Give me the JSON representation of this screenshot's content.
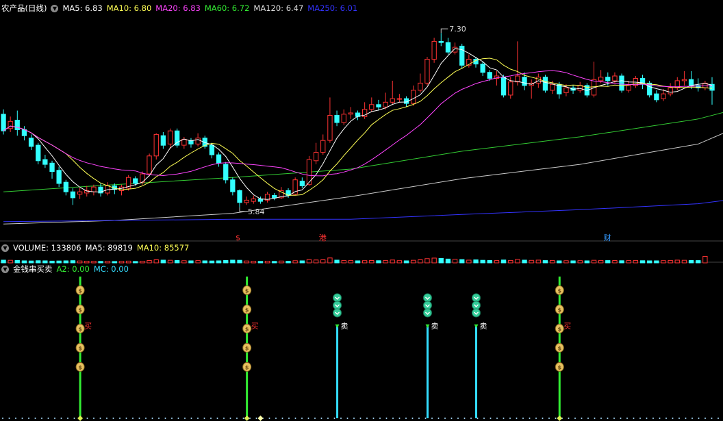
{
  "main_panel": {
    "title": "农产品(日线)",
    "indicators": [
      {
        "label": "MA5: 6.83",
        "color": "#ffffff"
      },
      {
        "label": "MA10: 6.80",
        "color": "#ffff55"
      },
      {
        "label": "MA20: 6.83",
        "color": "#ff44ff"
      },
      {
        "label": "MA60: 6.72",
        "color": "#33ee33"
      },
      {
        "label": "MA120: 6.47",
        "color": "#dddddd"
      },
      {
        "label": "MA250: 6.01",
        "color": "#3333ff"
      }
    ],
    "high_annotation": "7.30",
    "low_annotation": "5.84",
    "event_markers": [
      {
        "label": "$",
        "color": "#ff3333"
      },
      {
        "label": "港",
        "color": "#ff3333"
      },
      {
        "label": "财",
        "color": "#3399ff"
      }
    ]
  },
  "volume_panel": {
    "indicators": [
      {
        "label": "VOLUME: 133806",
        "color": "#ffffff"
      },
      {
        "label": "MA5: 89819",
        "color": "#ffffff"
      },
      {
        "label": "MA10: 85577",
        "color": "#ffff55"
      }
    ]
  },
  "signal_panel": {
    "title": "金钱串买卖",
    "indicators": [
      {
        "label": "A2: 0.00",
        "color": "#33ee33"
      },
      {
        "label": "MC: 0.00",
        "color": "#33ddff"
      }
    ],
    "buy_label": "买",
    "sell_label": "卖",
    "coin_glyph": "$"
  },
  "colors": {
    "up": "#ff3333",
    "down": "#33ffff",
    "buy_line": "#33ee33",
    "sell_line": "#33ddff",
    "coin": "#e8c060"
  },
  "chart_data": {
    "type": "candlestick",
    "ylim": [
      5.65,
      7.45
    ],
    "candles": [
      {
        "o": 6.62,
        "c": 6.48,
        "h": 6.66,
        "l": 6.45
      },
      {
        "o": 6.5,
        "c": 6.56,
        "h": 6.6,
        "l": 6.47
      },
      {
        "o": 6.57,
        "c": 6.49,
        "h": 6.65,
        "l": 6.44
      },
      {
        "o": 6.49,
        "c": 6.44,
        "h": 6.52,
        "l": 6.4
      },
      {
        "o": 6.42,
        "c": 6.35,
        "h": 6.45,
        "l": 6.32
      },
      {
        "o": 6.36,
        "c": 6.23,
        "h": 6.38,
        "l": 6.2
      },
      {
        "o": 6.24,
        "c": 6.2,
        "h": 6.28,
        "l": 6.17
      },
      {
        "o": 6.21,
        "c": 6.14,
        "h": 6.23,
        "l": 6.08
      },
      {
        "o": 6.15,
        "c": 6.04,
        "h": 6.18,
        "l": 6.01
      },
      {
        "o": 6.05,
        "c": 5.97,
        "h": 6.07,
        "l": 5.94
      },
      {
        "o": 5.97,
        "c": 5.92,
        "h": 6.0,
        "l": 5.86
      },
      {
        "o": 5.95,
        "c": 5.97,
        "h": 6.0,
        "l": 5.91
      },
      {
        "o": 5.96,
        "c": 5.98,
        "h": 6.02,
        "l": 5.93
      },
      {
        "o": 5.97,
        "c": 6.01,
        "h": 6.03,
        "l": 5.94
      },
      {
        "o": 6.01,
        "c": 5.96,
        "h": 6.04,
        "l": 5.93
      },
      {
        "o": 5.96,
        "c": 6.02,
        "h": 6.05,
        "l": 5.94
      },
      {
        "o": 6.02,
        "c": 5.99,
        "h": 6.04,
        "l": 5.95
      },
      {
        "o": 5.98,
        "c": 6.01,
        "h": 6.03,
        "l": 5.94
      },
      {
        "o": 6.0,
        "c": 6.09,
        "h": 6.11,
        "l": 5.98
      },
      {
        "o": 6.08,
        "c": 6.04,
        "h": 6.1,
        "l": 6.02
      },
      {
        "o": 6.05,
        "c": 6.12,
        "h": 6.14,
        "l": 6.03
      },
      {
        "o": 6.12,
        "c": 6.27,
        "h": 6.29,
        "l": 6.1
      },
      {
        "o": 6.27,
        "c": 6.45,
        "h": 6.46,
        "l": 6.24
      },
      {
        "o": 6.44,
        "c": 6.36,
        "h": 6.47,
        "l": 6.33
      },
      {
        "o": 6.37,
        "c": 6.48,
        "h": 6.5,
        "l": 6.33
      },
      {
        "o": 6.48,
        "c": 6.36,
        "h": 6.5,
        "l": 6.34
      },
      {
        "o": 6.36,
        "c": 6.41,
        "h": 6.43,
        "l": 6.33
      },
      {
        "o": 6.4,
        "c": 6.37,
        "h": 6.42,
        "l": 6.34
      },
      {
        "o": 6.37,
        "c": 6.42,
        "h": 6.46,
        "l": 6.35
      },
      {
        "o": 6.42,
        "c": 6.35,
        "h": 6.44,
        "l": 6.33
      },
      {
        "o": 6.36,
        "c": 6.28,
        "h": 6.38,
        "l": 6.25
      },
      {
        "o": 6.28,
        "c": 6.21,
        "h": 6.3,
        "l": 6.18
      },
      {
        "o": 6.2,
        "c": 6.07,
        "h": 6.22,
        "l": 6.04
      },
      {
        "o": 6.07,
        "c": 5.97,
        "h": 6.09,
        "l": 5.94
      },
      {
        "o": 5.98,
        "c": 5.88,
        "h": 5.99,
        "l": 5.84
      },
      {
        "o": 5.88,
        "c": 5.9,
        "h": 5.93,
        "l": 5.86
      },
      {
        "o": 5.89,
        "c": 5.91,
        "h": 5.94,
        "l": 5.87
      },
      {
        "o": 5.91,
        "c": 5.89,
        "h": 5.93,
        "l": 5.87
      },
      {
        "o": 5.9,
        "c": 5.95,
        "h": 5.97,
        "l": 5.88
      },
      {
        "o": 5.94,
        "c": 5.92,
        "h": 5.96,
        "l": 5.9
      },
      {
        "o": 5.92,
        "c": 5.98,
        "h": 6.01,
        "l": 5.91
      },
      {
        "o": 5.98,
        "c": 5.94,
        "h": 6.0,
        "l": 5.92
      },
      {
        "o": 5.95,
        "c": 6.07,
        "h": 6.09,
        "l": 5.94
      },
      {
        "o": 6.06,
        "c": 6.02,
        "h": 6.09,
        "l": 6.0
      },
      {
        "o": 6.03,
        "c": 6.24,
        "h": 6.27,
        "l": 6.02
      },
      {
        "o": 6.23,
        "c": 6.3,
        "h": 6.38,
        "l": 6.2
      },
      {
        "o": 6.3,
        "c": 6.4,
        "h": 6.45,
        "l": 6.28
      },
      {
        "o": 6.4,
        "c": 6.61,
        "h": 6.76,
        "l": 6.38
      },
      {
        "o": 6.61,
        "c": 6.55,
        "h": 6.65,
        "l": 6.52
      },
      {
        "o": 6.55,
        "c": 6.62,
        "h": 6.66,
        "l": 6.53
      },
      {
        "o": 6.62,
        "c": 6.63,
        "h": 6.68,
        "l": 6.58
      },
      {
        "o": 6.63,
        "c": 6.6,
        "h": 6.65,
        "l": 6.57
      },
      {
        "o": 6.6,
        "c": 6.66,
        "h": 6.72,
        "l": 6.58
      },
      {
        "o": 6.66,
        "c": 6.7,
        "h": 6.76,
        "l": 6.64
      },
      {
        "o": 6.7,
        "c": 6.68,
        "h": 6.74,
        "l": 6.65
      },
      {
        "o": 6.68,
        "c": 6.72,
        "h": 6.8,
        "l": 6.66
      },
      {
        "o": 6.72,
        "c": 6.75,
        "h": 6.9,
        "l": 6.7
      },
      {
        "o": 6.75,
        "c": 6.75,
        "h": 6.79,
        "l": 6.72
      },
      {
        "o": 6.75,
        "c": 6.71,
        "h": 6.77,
        "l": 6.68
      },
      {
        "o": 6.71,
        "c": 6.82,
        "h": 6.86,
        "l": 6.69
      },
      {
        "o": 6.82,
        "c": 6.88,
        "h": 6.96,
        "l": 6.8
      },
      {
        "o": 6.88,
        "c": 7.08,
        "h": 7.1,
        "l": 6.86
      },
      {
        "o": 7.08,
        "c": 7.23,
        "h": 7.26,
        "l": 7.05
      },
      {
        "o": 7.23,
        "c": 7.22,
        "h": 7.3,
        "l": 7.19
      },
      {
        "o": 7.22,
        "c": 7.14,
        "h": 7.26,
        "l": 7.12
      },
      {
        "o": 7.14,
        "c": 7.18,
        "h": 7.22,
        "l": 7.12
      },
      {
        "o": 7.19,
        "c": 7.03,
        "h": 7.21,
        "l": 7.0
      },
      {
        "o": 7.03,
        "c": 7.08,
        "h": 7.12,
        "l": 7.01
      },
      {
        "o": 7.08,
        "c": 7.04,
        "h": 7.1,
        "l": 7.01
      },
      {
        "o": 7.04,
        "c": 6.97,
        "h": 7.06,
        "l": 6.94
      },
      {
        "o": 6.97,
        "c": 6.92,
        "h": 6.99,
        "l": 6.9
      },
      {
        "o": 6.92,
        "c": 6.94,
        "h": 6.98,
        "l": 6.86
      },
      {
        "o": 6.93,
        "c": 6.78,
        "h": 6.95,
        "l": 6.76
      },
      {
        "o": 6.78,
        "c": 6.89,
        "h": 6.93,
        "l": 6.75
      },
      {
        "o": 6.89,
        "c": 6.94,
        "h": 7.23,
        "l": 6.86
      },
      {
        "o": 6.93,
        "c": 6.86,
        "h": 6.97,
        "l": 6.82
      },
      {
        "o": 6.86,
        "c": 6.88,
        "h": 6.91,
        "l": 6.75
      },
      {
        "o": 6.88,
        "c": 6.93,
        "h": 6.96,
        "l": 6.84
      },
      {
        "o": 6.93,
        "c": 6.82,
        "h": 6.95,
        "l": 6.8
      },
      {
        "o": 6.82,
        "c": 6.87,
        "h": 6.9,
        "l": 6.79
      },
      {
        "o": 6.87,
        "c": 6.79,
        "h": 6.89,
        "l": 6.75
      },
      {
        "o": 6.8,
        "c": 6.84,
        "h": 6.87,
        "l": 6.77
      },
      {
        "o": 6.84,
        "c": 6.82,
        "h": 6.86,
        "l": 6.79
      },
      {
        "o": 6.82,
        "c": 6.86,
        "h": 6.89,
        "l": 6.8
      },
      {
        "o": 6.86,
        "c": 6.78,
        "h": 6.88,
        "l": 6.76
      },
      {
        "o": 6.78,
        "c": 6.91,
        "h": 7.06,
        "l": 6.76
      },
      {
        "o": 6.9,
        "c": 6.93,
        "h": 6.99,
        "l": 6.88
      },
      {
        "o": 6.93,
        "c": 6.9,
        "h": 6.97,
        "l": 6.86
      },
      {
        "o": 6.9,
        "c": 6.94,
        "h": 6.97,
        "l": 6.88
      },
      {
        "o": 6.94,
        "c": 6.82,
        "h": 6.96,
        "l": 6.8
      },
      {
        "o": 6.82,
        "c": 6.86,
        "h": 6.9,
        "l": 6.8
      },
      {
        "o": 6.86,
        "c": 6.92,
        "h": 6.94,
        "l": 6.84
      },
      {
        "o": 6.92,
        "c": 6.87,
        "h": 6.95,
        "l": 6.83
      },
      {
        "o": 6.88,
        "c": 6.78,
        "h": 6.9,
        "l": 6.76
      },
      {
        "o": 6.79,
        "c": 6.74,
        "h": 6.82,
        "l": 6.72
      },
      {
        "o": 6.75,
        "c": 6.79,
        "h": 6.83,
        "l": 6.73
      },
      {
        "o": 6.79,
        "c": 6.84,
        "h": 6.88,
        "l": 6.77
      },
      {
        "o": 6.84,
        "c": 6.9,
        "h": 6.93,
        "l": 6.82
      },
      {
        "o": 6.9,
        "c": 6.91,
        "h": 6.98,
        "l": 6.86
      },
      {
        "o": 6.91,
        "c": 6.86,
        "h": 6.98,
        "l": 6.83
      },
      {
        "o": 6.86,
        "c": 6.84,
        "h": 6.92,
        "l": 6.81
      },
      {
        "o": 6.84,
        "c": 6.88,
        "h": 6.9,
        "l": 6.82
      },
      {
        "o": 6.87,
        "c": 6.82,
        "h": 6.93,
        "l": 6.7
      }
    ],
    "volumes": [
      40,
      38,
      35,
      30,
      28,
      32,
      30,
      26,
      28,
      30,
      33,
      28,
      25,
      24,
      22,
      24,
      20,
      22,
      26,
      21,
      25,
      35,
      45,
      40,
      38,
      35,
      32,
      30,
      34,
      30,
      28,
      30,
      36,
      40,
      38,
      28,
      24,
      22,
      25,
      22,
      27,
      24,
      32,
      30,
      48,
      42,
      45,
      72,
      40,
      36,
      34,
      30,
      33,
      35,
      32,
      36,
      42,
      33,
      30,
      38,
      45,
      62,
      70,
      66,
      56,
      52,
      48,
      40,
      44,
      38,
      36,
      34,
      42,
      36,
      50,
      40,
      37,
      40,
      34,
      36,
      30,
      32,
      30,
      33,
      30,
      38,
      36,
      34,
      35,
      32,
      34,
      36,
      32,
      30,
      30,
      33,
      36,
      40,
      38,
      36,
      34,
      95
    ],
    "vol_max": 140,
    "ma_periods": {
      "MA5": 5,
      "MA10": 10,
      "MA20": 20
    },
    "long_ma": {
      "MA60": [
        [
          0,
          5.97
        ],
        [
          16,
          6.03
        ],
        [
          33,
          6.09
        ],
        [
          50,
          6.16
        ],
        [
          66,
          6.31
        ],
        [
          83,
          6.43
        ],
        [
          100,
          6.58
        ],
        [
          104,
          6.64
        ]
      ],
      "MA120": [
        [
          0,
          5.7
        ],
        [
          16,
          5.73
        ],
        [
          33,
          5.79
        ],
        [
          50,
          5.93
        ],
        [
          66,
          6.08
        ],
        [
          83,
          6.2
        ],
        [
          100,
          6.37
        ],
        [
          104,
          6.47
        ]
      ],
      "MA250": [
        [
          0,
          5.72
        ],
        [
          33,
          5.74
        ],
        [
          50,
          5.74
        ],
        [
          66,
          5.78
        ],
        [
          83,
          5.82
        ],
        [
          100,
          5.87
        ],
        [
          104,
          5.9
        ]
      ]
    },
    "high_index": 63,
    "low_index": 34,
    "event_indices": [
      34,
      46,
      87
    ],
    "signals": [
      {
        "type": "buy",
        "index": 11,
        "coins": 5
      },
      {
        "type": "buy",
        "index": 35,
        "coins": 5
      },
      {
        "type": "sell",
        "index": 48,
        "coins": 3
      },
      {
        "type": "sell",
        "index": 61,
        "coins": 3
      },
      {
        "type": "sell",
        "index": 68,
        "coins": 3
      },
      {
        "type": "buy",
        "index": 80,
        "coins": 5
      }
    ]
  }
}
